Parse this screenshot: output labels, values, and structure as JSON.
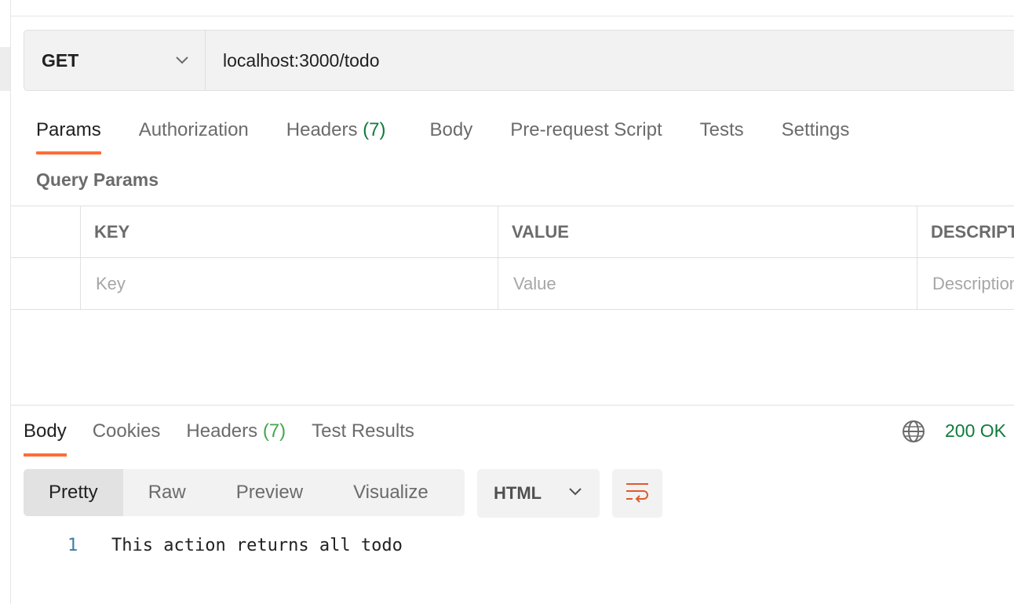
{
  "request": {
    "method": "GET",
    "url": "localhost:3000/todo"
  },
  "request_tabs": {
    "params": "Params",
    "authorization": "Authorization",
    "headers": "Headers",
    "headers_count": "(7)",
    "body": "Body",
    "pre_request": "Pre-request Script",
    "tests": "Tests",
    "settings": "Settings"
  },
  "query_params": {
    "title": "Query Params",
    "columns": [
      "KEY",
      "VALUE",
      "DESCRIPTION"
    ],
    "placeholders": [
      "Key",
      "Value",
      "Description"
    ]
  },
  "response": {
    "tabs": {
      "body": "Body",
      "cookies": "Cookies",
      "headers": "Headers",
      "headers_count": "(7)",
      "test_results": "Test Results"
    },
    "status": "200 OK",
    "view_modes": [
      "Pretty",
      "Raw",
      "Preview",
      "Visualize"
    ],
    "active_view": "Pretty",
    "format": "HTML",
    "lines": [
      {
        "number": "1",
        "text": "This action returns all todo"
      }
    ]
  },
  "colors": {
    "accent": "#ff6c37",
    "status_green": "#0f7b3b"
  }
}
